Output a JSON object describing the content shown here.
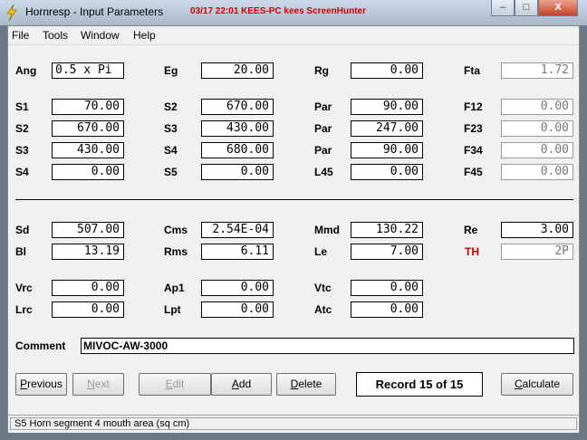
{
  "window": {
    "title": "Hornresp - Input Parameters",
    "title_extra": "03/17 22:01 KEES-PC kees ScreenHunter",
    "minimize_glyph": "–",
    "maximize_glyph": "□",
    "close_glyph": "X"
  },
  "menu": [
    "File",
    "Tools",
    "Window",
    "Help"
  ],
  "params": {
    "ang": {
      "label": "Ang",
      "value": "0.5 x Pi"
    },
    "eg": {
      "label": "Eg",
      "value": "20.00"
    },
    "rg": {
      "label": "Rg",
      "value": "0.00"
    },
    "fta": {
      "label": "Fta",
      "value": "1.72"
    },
    "s1": {
      "label": "S1",
      "value": "70.00"
    },
    "s2a": {
      "label": "S2",
      "value": "670.00"
    },
    "par1": {
      "label": "Par",
      "value": "90.00"
    },
    "f12": {
      "label": "F12",
      "value": "0.00"
    },
    "s2b": {
      "label": "S2",
      "value": "670.00"
    },
    "s3a": {
      "label": "S3",
      "value": "430.00"
    },
    "par2": {
      "label": "Par",
      "value": "247.00"
    },
    "f23": {
      "label": "F23",
      "value": "0.00"
    },
    "s3b": {
      "label": "S3",
      "value": "430.00"
    },
    "s4a": {
      "label": "S4",
      "value": "680.00"
    },
    "par3": {
      "label": "Par",
      "value": "90.00"
    },
    "f34": {
      "label": "F34",
      "value": "0.00"
    },
    "s4b": {
      "label": "S4",
      "value": "0.00"
    },
    "s5": {
      "label": "S5",
      "value": "0.00"
    },
    "l45": {
      "label": "L45",
      "value": "0.00"
    },
    "f45": {
      "label": "F45",
      "value": "0.00"
    },
    "sd": {
      "label": "Sd",
      "value": "507.00"
    },
    "cms": {
      "label": "Cms",
      "value": "2.54E-04"
    },
    "mmd": {
      "label": "Mmd",
      "value": "130.22"
    },
    "re": {
      "label": "Re",
      "value": "3.00"
    },
    "bl": {
      "label": "Bl",
      "value": "13.19"
    },
    "rms": {
      "label": "Rms",
      "value": "6.11"
    },
    "le": {
      "label": "Le",
      "value": "7.00"
    },
    "th": {
      "label": "TH",
      "value": "2P"
    },
    "vrc": {
      "label": "Vrc",
      "value": "0.00"
    },
    "ap1": {
      "label": "Ap1",
      "value": "0.00"
    },
    "vtc": {
      "label": "Vtc",
      "value": "0.00"
    },
    "lrc": {
      "label": "Lrc",
      "value": "0.00"
    },
    "lpt": {
      "label": "Lpt",
      "value": "0.00"
    },
    "atc": {
      "label": "Atc",
      "value": "0.00"
    }
  },
  "comment": {
    "label": "Comment",
    "value": "MIVOC-AW-3000"
  },
  "buttons": {
    "previous": {
      "pre": "",
      "u": "P",
      "post": "revious"
    },
    "next": {
      "pre": "",
      "u": "N",
      "post": "ext"
    },
    "edit": {
      "pre": "",
      "u": "E",
      "post": "dit"
    },
    "add": {
      "pre": "",
      "u": "A",
      "post": "dd"
    },
    "delete": {
      "pre": "",
      "u": "D",
      "post": "elete"
    },
    "calculate": {
      "pre": "",
      "u": "C",
      "post": "alculate"
    }
  },
  "record": "Record 15 of 15",
  "status": "S5   Horn segment 4 mouth area  (sq cm)",
  "colors": {
    "accent_red": "#c00000",
    "title_red": "#d00000"
  }
}
